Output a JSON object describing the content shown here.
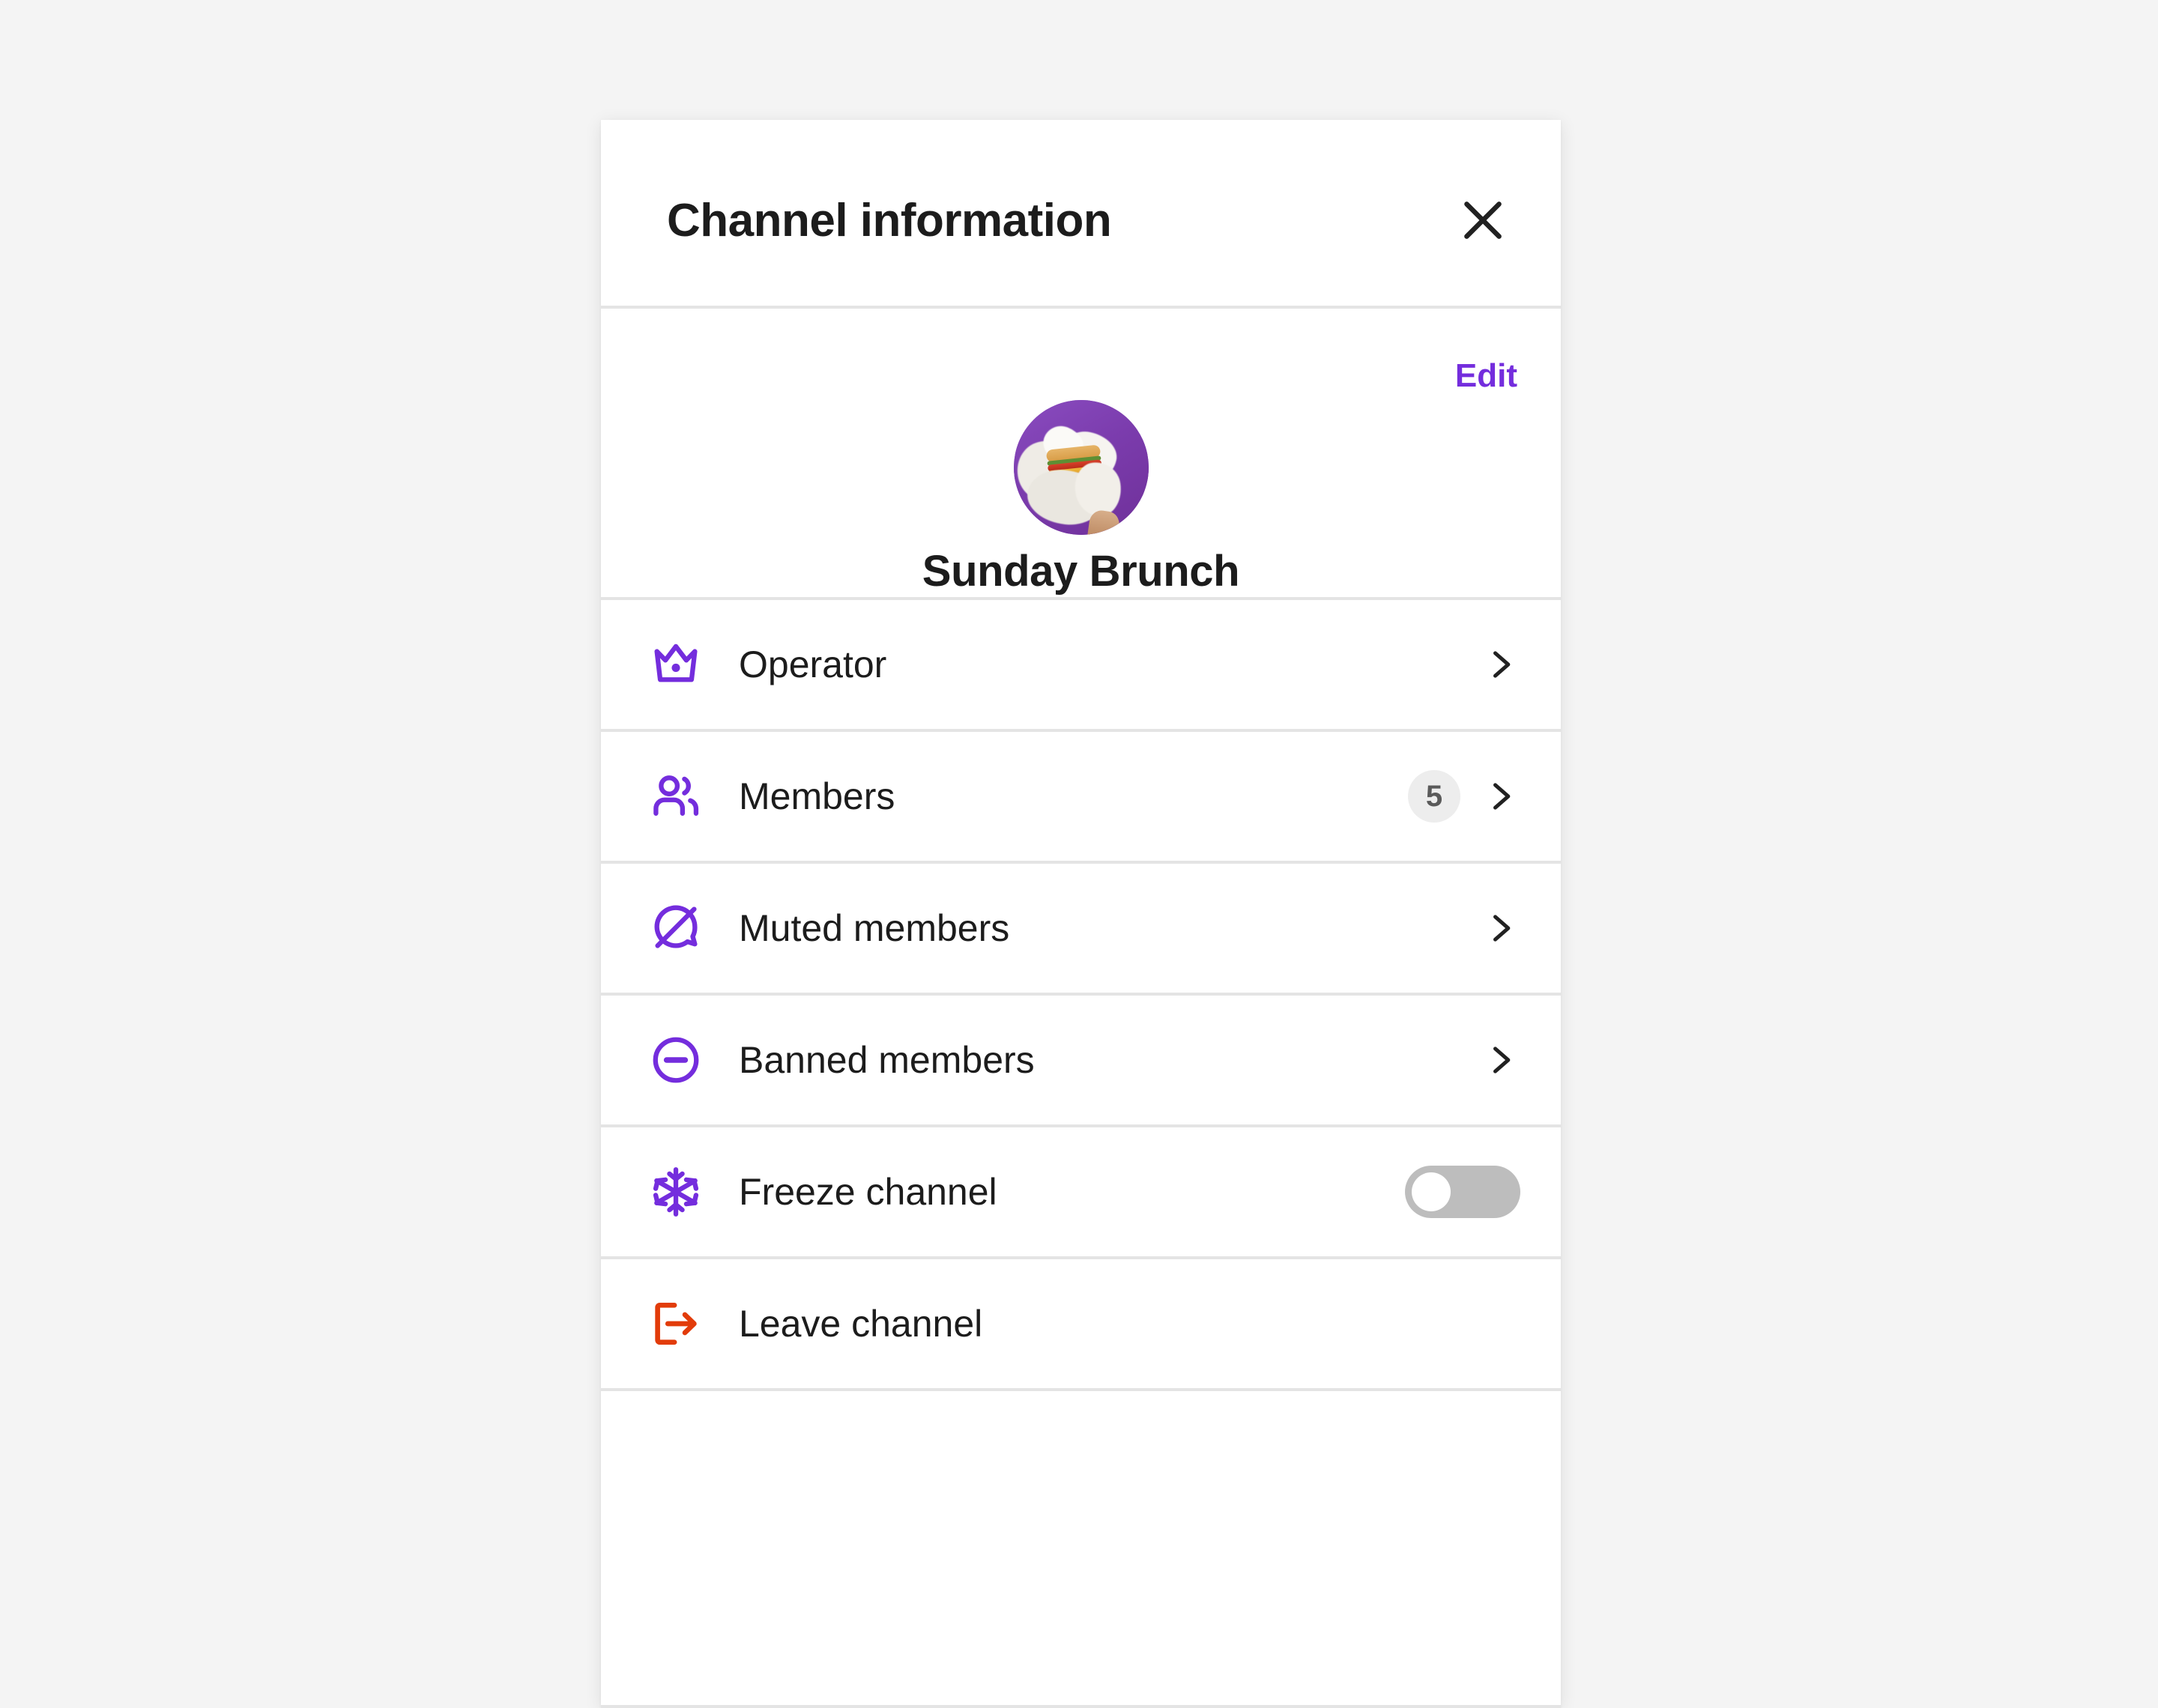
{
  "theme": {
    "page_background": "#f4f4f4",
    "panel_background": "#ffffff",
    "accent_purple": "#742ddd",
    "danger_orange": "#e23c0a",
    "divider": "#e4e4e4",
    "text_primary": "#1c1c1c",
    "badge_background": "#ededed",
    "badge_text": "#5a5a5a",
    "toggle_off_track": "#bdbdbd",
    "toggle_knob": "#ffffff",
    "avatar_background": "#7b3fae"
  },
  "header": {
    "title": "Channel information",
    "close_icon": "close-icon"
  },
  "profile": {
    "edit_label": "Edit",
    "channel_name": "Sunday Brunch",
    "avatar_alt": "burger-in-paper-photo"
  },
  "menu": {
    "items": [
      {
        "id": "operator",
        "label": "Operator",
        "icon": "crown-icon",
        "icon_color": "#742ddd",
        "accessory": "chevron",
        "badge": null
      },
      {
        "id": "members",
        "label": "Members",
        "icon": "people-icon",
        "icon_color": "#742ddd",
        "accessory": "chevron",
        "badge": "5"
      },
      {
        "id": "muted-members",
        "label": "Muted members",
        "icon": "muted-bubble-icon",
        "icon_color": "#742ddd",
        "accessory": "chevron",
        "badge": null
      },
      {
        "id": "banned-members",
        "label": "Banned members",
        "icon": "circle-minus-icon",
        "icon_color": "#742ddd",
        "accessory": "chevron",
        "badge": null
      },
      {
        "id": "freeze-channel",
        "label": "Freeze channel",
        "icon": "snowflake-icon",
        "icon_color": "#742ddd",
        "accessory": "toggle",
        "toggle_state": "off",
        "badge": null
      },
      {
        "id": "leave-channel",
        "label": "Leave channel",
        "icon": "exit-icon",
        "icon_color": "#e23c0a",
        "accessory": "none",
        "badge": null
      }
    ]
  }
}
